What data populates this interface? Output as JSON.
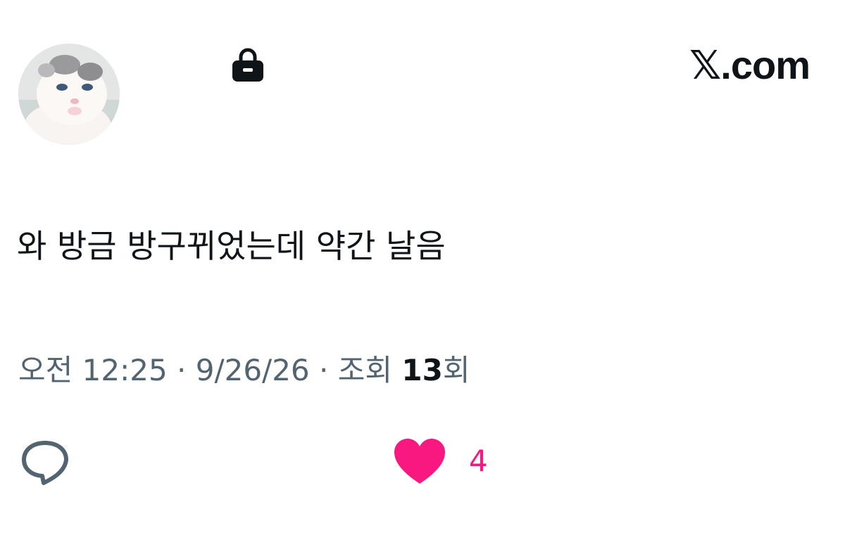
{
  "header": {
    "site_label": "𝕏.com",
    "avatar_icon": "kitten-avatar-icon",
    "lock_icon": "lock-icon"
  },
  "tweet": {
    "text": "와 방금 방구뀌었는데 약간 날음"
  },
  "meta": {
    "time": "오전 12:25",
    "separator_1": " · ",
    "date": "9/26/26",
    "separator_2": " · ",
    "views_prefix": "조회 ",
    "views_count": "13",
    "views_suffix": "회"
  },
  "actions": {
    "reply_icon": "speech-bubble-icon",
    "like_icon": "heart-icon",
    "like_count": "4",
    "like_color": "#f91880"
  },
  "colors": {
    "text_primary": "#0f1419",
    "text_secondary": "#536471",
    "like_pink": "#f91880"
  }
}
